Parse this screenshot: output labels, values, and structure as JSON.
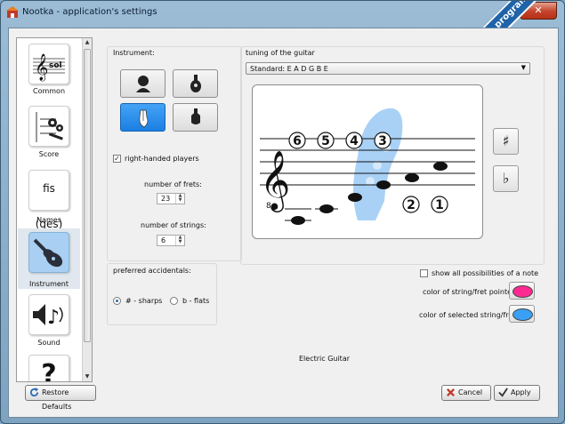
{
  "window": {
    "title": "Nootka - application's settings",
    "close": "✕"
  },
  "watermark": {
    "text": "programecalculator.ro"
  },
  "sidebar": {
    "items": [
      {
        "label": "Common",
        "icon": "clef-sol-icon"
      },
      {
        "label": "Score",
        "icon": "score-gears-icon"
      },
      {
        "label": "Names",
        "icon": "names-icon",
        "text": "fis (ges)"
      },
      {
        "label": "Instrument",
        "icon": "guitar-icon"
      },
      {
        "label": "Sound",
        "icon": "speaker-note-icon"
      }
    ]
  },
  "instrument": {
    "label": "Instrument:",
    "right_handed_label": "right-handed players",
    "right_handed_checked": true,
    "frets_label": "number of frets:",
    "frets_value": "23",
    "strings_label": "number of strings:",
    "strings_value": "6"
  },
  "tuning": {
    "label": "tuning of the guitar",
    "selected": "Standard: E A D G B E",
    "string_numbers_top": [
      "6",
      "5",
      "4",
      "3"
    ],
    "string_numbers_bottom": [
      "2",
      "1"
    ],
    "clef_octave": "8",
    "sharp": "♯",
    "flat": "♭"
  },
  "accidentals": {
    "label": "preferred accidentals:",
    "sharps_label": "# - sharps",
    "flats_label": "b - flats",
    "selected": "sharps"
  },
  "options": {
    "show_all_label": "show all possibilities of a note",
    "pointer_color_label": "color of string/fret pointer",
    "selected_color_label": "color of selected string/fret",
    "pointer_color": "#ff2a91",
    "selected_color": "#3aa0f5"
  },
  "instrument_name": "Electric Guitar",
  "footer": {
    "restore": "Restore Defaults",
    "cancel": "Cancel",
    "apply": "Apply"
  }
}
